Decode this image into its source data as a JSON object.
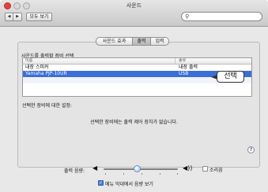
{
  "window": {
    "title": "사운드"
  },
  "toolbar": {
    "back_glyph": "◀",
    "forward_glyph": "▶",
    "show_all_label": "모두 보기",
    "search_placeholder": "",
    "search_value": "",
    "search_icon": "search-icon"
  },
  "tabs": [
    {
      "label": "사운드 효과",
      "selected": false
    },
    {
      "label": "출력",
      "selected": true
    },
    {
      "label": "입력",
      "selected": false
    }
  ],
  "output": {
    "instruction": "사운드를 출력할 장비 선택",
    "columns": [
      "이름",
      "종류"
    ],
    "rows": [
      {
        "name": "내장 스피커",
        "type": "내장 출력",
        "selected": false
      },
      {
        "name": "Yamaha PJP-10UR",
        "type": "USB",
        "selected": true
      }
    ],
    "callout": "선택",
    "settings_label": "선택한 장비에 대한 설정:",
    "no_controls_message": "선택한 장비에는 출력 제어 장치가 없습니다."
  },
  "help": {
    "label": "?"
  },
  "volume": {
    "label": "출력 음량:",
    "level": 0.45,
    "low_icon": "speaker-low-icon",
    "high_icon": "speaker-high-icon",
    "low_glyph": "◀",
    "high_glyph": "◀))",
    "mute_label": "소리끔",
    "mute_checked": false
  },
  "menu_bar_option": {
    "label": "메뉴 막대에서 음량 보기",
    "checked": true
  },
  "colors": {
    "selection": "#3b6fd6",
    "close": "#e0443e"
  }
}
